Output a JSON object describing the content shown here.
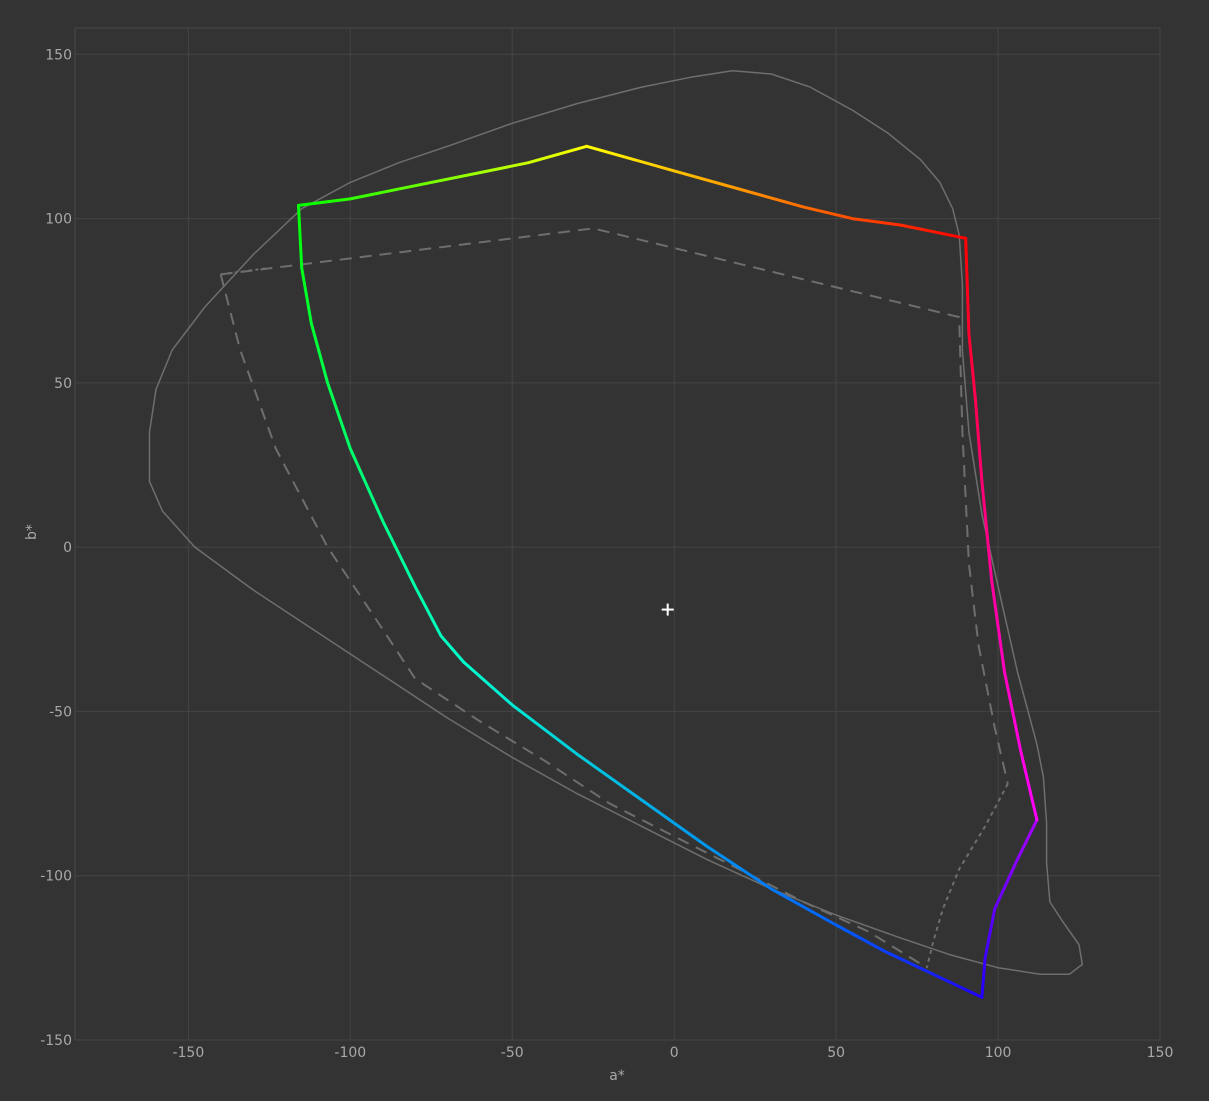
{
  "chart_data": {
    "type": "line",
    "xlabel": "a*",
    "ylabel": "b*",
    "xlim": [
      -185,
      150
    ],
    "ylim": [
      -150,
      158
    ],
    "x_ticks": [
      -150,
      -100,
      -50,
      0,
      50,
      100,
      150
    ],
    "y_ticks": [
      150,
      100,
      50,
      0,
      -50,
      -100,
      -150
    ],
    "grid": true,
    "colors": {
      "background": "#333333",
      "grid": "#454545",
      "frame": "#4a4a4a",
      "tick_text": "#a8a8a8",
      "reference_line": "#6e6e6e",
      "marker": "#ffffff"
    },
    "gamut_edges": [
      {
        "from_color": "#ff0000",
        "to_color": "#ffff00",
        "points": [
          [
            90,
            94
          ],
          [
            80,
            96
          ],
          [
            70,
            98
          ],
          [
            55,
            100
          ],
          [
            40,
            103.5
          ],
          [
            20,
            109
          ],
          [
            0,
            114.5
          ],
          [
            -27,
            122
          ]
        ]
      },
      {
        "from_color": "#ffff00",
        "to_color": "#00ff00",
        "points": [
          [
            -27,
            122
          ],
          [
            -45,
            117
          ],
          [
            -60,
            114
          ],
          [
            -80,
            110
          ],
          [
            -100,
            106
          ],
          [
            -116,
            104
          ]
        ]
      },
      {
        "from_color": "#00ff00",
        "to_color": "#00ffcc",
        "points": [
          [
            -116,
            104
          ],
          [
            -115,
            85
          ],
          [
            -112,
            68
          ],
          [
            -107,
            50
          ],
          [
            -100,
            30
          ],
          [
            -90,
            8
          ],
          [
            -80,
            -12
          ],
          [
            -72,
            -27
          ],
          [
            -65,
            -35
          ]
        ]
      },
      {
        "from_color": "#00ffcc",
        "to_color": "#0060ff",
        "points": [
          [
            -65,
            -35
          ],
          [
            -50,
            -48
          ],
          [
            -30,
            -63
          ],
          [
            -10,
            -77
          ],
          [
            10,
            -91
          ],
          [
            30,
            -104
          ],
          [
            50,
            -115
          ]
        ]
      },
      {
        "from_color": "#0060ff",
        "to_color": "#2000ff",
        "points": [
          [
            50,
            -115
          ],
          [
            65,
            -123
          ],
          [
            80,
            -130
          ],
          [
            95,
            -137
          ]
        ]
      },
      {
        "from_color": "#2000ff",
        "to_color": "#aa00ff",
        "points": [
          [
            95,
            -137
          ],
          [
            96,
            -125
          ],
          [
            99,
            -110
          ],
          [
            106,
            -95
          ],
          [
            112,
            -83
          ]
        ]
      },
      {
        "from_color": "#ff00ff",
        "to_color": "#ff0050",
        "points": [
          [
            112,
            -83
          ],
          [
            107,
            -62
          ],
          [
            102,
            -38
          ],
          [
            98,
            -10
          ],
          [
            95,
            20
          ],
          [
            93,
            45
          ]
        ]
      },
      {
        "from_color": "#ff0050",
        "to_color": "#ff0000",
        "points": [
          [
            93,
            45
          ],
          [
            91,
            65
          ],
          [
            90,
            94
          ]
        ]
      }
    ],
    "reference_outline": [
      [
        18,
        145
      ],
      [
        5,
        143
      ],
      [
        -10,
        140
      ],
      [
        -30,
        135
      ],
      [
        -50,
        129
      ],
      [
        -70,
        122
      ],
      [
        -85,
        117
      ],
      [
        -100,
        111
      ],
      [
        -115,
        103
      ],
      [
        -130,
        89
      ],
      [
        -145,
        73
      ],
      [
        -155,
        60
      ],
      [
        -160,
        48
      ],
      [
        -162,
        35
      ],
      [
        -162,
        20
      ],
      [
        -158,
        11
      ],
      [
        -148,
        0
      ],
      [
        -130,
        -13
      ],
      [
        -110,
        -26
      ],
      [
        -90,
        -39
      ],
      [
        -70,
        -52
      ],
      [
        -50,
        -64
      ],
      [
        -30,
        -75
      ],
      [
        -10,
        -85
      ],
      [
        10,
        -95
      ],
      [
        30,
        -104
      ],
      [
        50,
        -112
      ],
      [
        70,
        -119
      ],
      [
        85,
        -124
      ],
      [
        100,
        -128
      ],
      [
        113,
        -130
      ],
      [
        122,
        -130
      ],
      [
        126,
        -127
      ],
      [
        125,
        -121
      ],
      [
        120,
        -114
      ],
      [
        116,
        -108
      ],
      [
        115,
        -96
      ],
      [
        115,
        -84
      ],
      [
        114,
        -70
      ],
      [
        112,
        -60
      ],
      [
        106,
        -38
      ],
      [
        100,
        -12
      ],
      [
        95,
        10
      ],
      [
        91,
        35
      ],
      [
        89,
        60
      ],
      [
        89,
        80
      ],
      [
        88,
        95
      ],
      [
        86,
        103
      ],
      [
        82,
        111
      ],
      [
        76,
        118
      ],
      [
        66,
        126
      ],
      [
        55,
        133
      ],
      [
        42,
        140
      ],
      [
        30,
        144
      ],
      [
        18,
        145
      ]
    ],
    "reference_dashed": [
      [
        -140,
        83
      ],
      [
        -25,
        97
      ],
      [
        88,
        70
      ],
      [
        89,
        35
      ],
      [
        91,
        -5
      ],
      [
        94,
        -30
      ],
      [
        99,
        -55
      ],
      [
        103,
        -72
      ]
    ],
    "reference_dashed_lower": [
      [
        -140,
        83
      ],
      [
        -134,
        60
      ],
      [
        -123,
        30
      ],
      [
        -107,
        0
      ],
      [
        -90,
        -25
      ],
      [
        -80,
        -40
      ],
      [
        -60,
        -53
      ],
      [
        -40,
        -65
      ],
      [
        -20,
        -78
      ],
      [
        0,
        -88
      ],
      [
        20,
        -98
      ],
      [
        40,
        -108
      ],
      [
        60,
        -117
      ],
      [
        78,
        -128
      ]
    ],
    "reference_dotted": [
      [
        -140,
        83
      ],
      [
        -125,
        85
      ]
    ],
    "reference_dotted_right": [
      [
        103,
        -72
      ],
      [
        96,
        -85
      ],
      [
        88,
        -98
      ],
      [
        83,
        -110
      ],
      [
        80,
        -120
      ],
      [
        78,
        -128
      ]
    ],
    "center_marker": [
      -2,
      -19
    ]
  }
}
